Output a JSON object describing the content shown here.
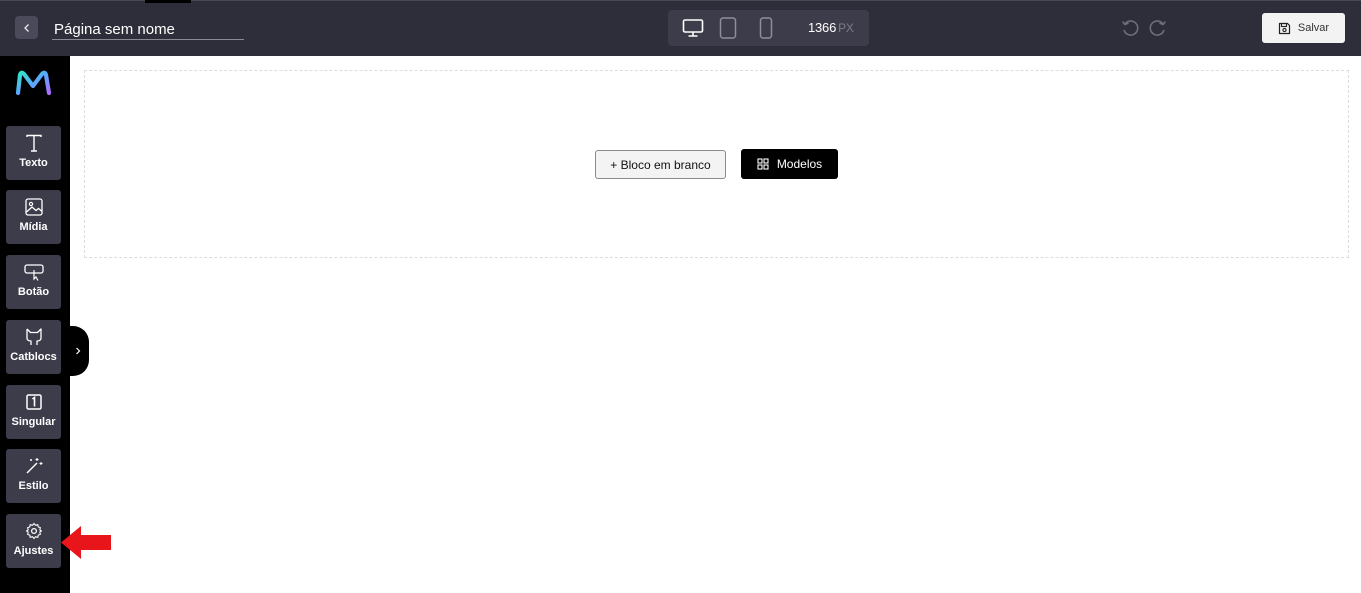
{
  "header": {
    "page_name": "Página sem nome",
    "viewport_width": "1366",
    "viewport_unit": "PX",
    "save_label": "Salvar"
  },
  "sidebar": {
    "items": [
      {
        "label": "Texto",
        "icon": "text-icon"
      },
      {
        "label": "Mídia",
        "icon": "image-icon"
      },
      {
        "label": "Botão",
        "icon": "button-cursor-icon"
      },
      {
        "label": "Catblocs",
        "icon": "cat-icon"
      },
      {
        "label": "Singular",
        "icon": "one-box-icon"
      },
      {
        "label": "Estilo",
        "icon": "magic-wand-icon"
      },
      {
        "label": "Ajustes",
        "icon": "gear-icon"
      }
    ]
  },
  "canvas": {
    "blank_block_label": "+ Bloco em branco",
    "models_label": "Modelos"
  },
  "colors": {
    "topbar": "#2e2d3a",
    "sidebar": "#000000",
    "tool_bg": "#3d3c4b",
    "annotation_arrow": "#e8161b"
  }
}
